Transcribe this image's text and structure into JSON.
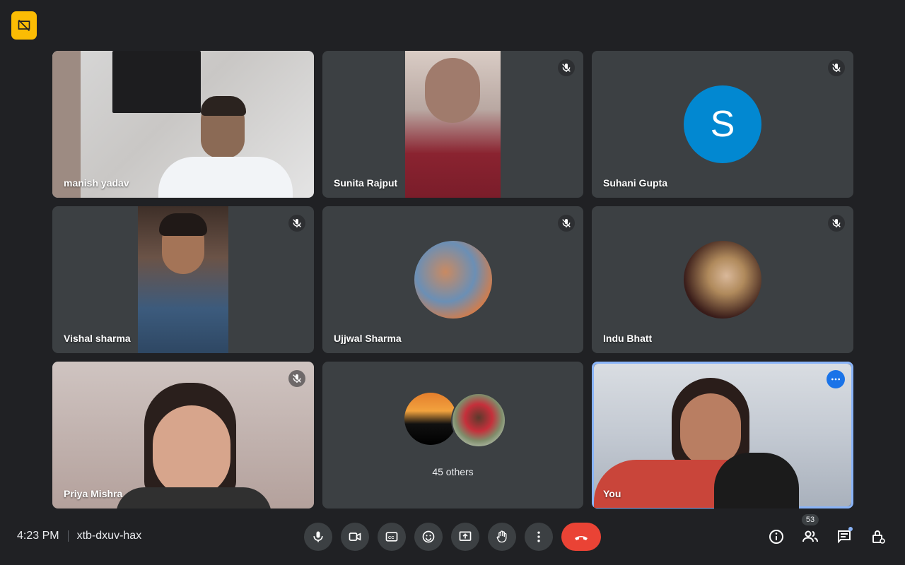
{
  "meeting": {
    "time": "4:23 PM",
    "code": "xtb-dxuv-hax"
  },
  "participants": {
    "manish": {
      "name": "manish yadav"
    },
    "sunita": {
      "name": "Sunita Rajput"
    },
    "suhani": {
      "name": "Suhani Gupta",
      "initial": "S"
    },
    "vishal": {
      "name": "Vishal sharma"
    },
    "ujjwal": {
      "name": "Ujjwal Sharma"
    },
    "indu": {
      "name": "Indu Bhatt"
    },
    "priya": {
      "name": "Priya Mishra"
    },
    "others": {
      "label": "45 others"
    },
    "self": {
      "name": "You"
    }
  },
  "people_count": "53",
  "icons": [
    "present-off-icon",
    "mic-off-icon",
    "mic-icon",
    "camera-icon",
    "captions-icon",
    "emoji-icon",
    "present-icon",
    "raise-hand-icon",
    "more-vert-icon",
    "end-call-icon",
    "info-icon",
    "people-icon",
    "chat-icon",
    "host-controls-icon"
  ],
  "colors": {
    "accent": "#8ab4f8",
    "end_call": "#ea4335",
    "badge": "#fbbc04",
    "avatar_s": "#0288d1"
  }
}
